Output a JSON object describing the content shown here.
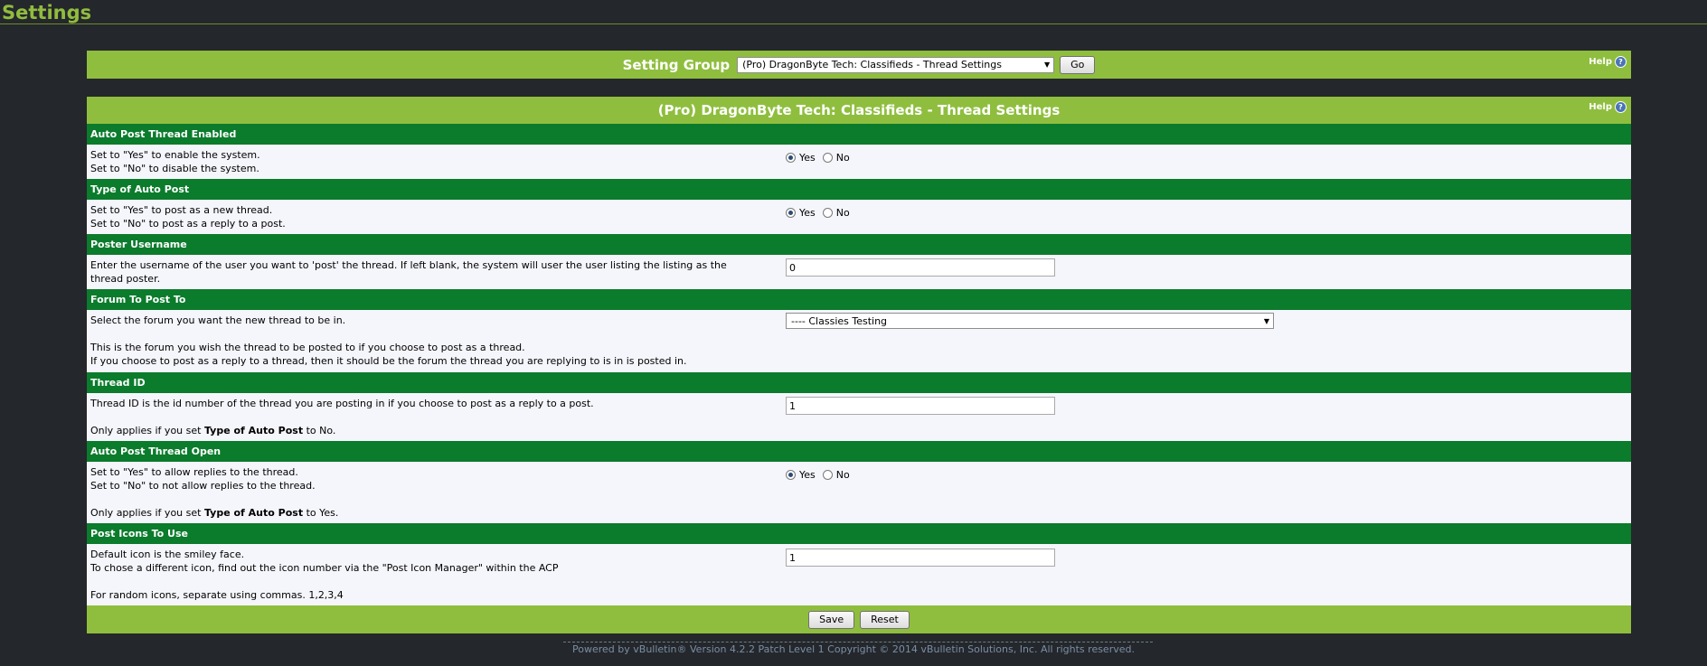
{
  "page": {
    "title": "Settings"
  },
  "group": {
    "label": "Setting Group",
    "selected": "(Pro) DragonByte Tech: Classifieds - Thread Settings",
    "go_label": "Go",
    "help_label": "Help"
  },
  "table": {
    "title": "(Pro) DragonByte Tech: Classifieds - Thread Settings",
    "help_label": "Help"
  },
  "settings": {
    "auto_post": {
      "heading": "Auto Post Thread Enabled",
      "desc1": "Set to \"Yes\" to enable the system.",
      "desc2": "Set to \"No\" to disable the system.",
      "yes": "Yes",
      "no": "No",
      "value": "Yes"
    },
    "type_post": {
      "heading": "Type of Auto Post",
      "desc1": "Set to \"Yes\" to post as a new thread.",
      "desc2": "Set to \"No\" to post as a reply to a post.",
      "yes": "Yes",
      "no": "No",
      "value": "Yes"
    },
    "poster": {
      "heading": "Poster Username",
      "desc1": "Enter the username of the user you want to 'post' the thread. If left blank, the system will user the user listing the listing as the",
      "desc2": "thread poster.",
      "value": "0"
    },
    "forum": {
      "heading": "Forum To Post To",
      "desc1": "Select the forum you want the new thread to be in.",
      "desc2": "This is the forum you wish the thread to be posted to if you choose to post as a thread.",
      "desc3": "If you choose to post as a reply to a thread, then it should be the forum the thread you are replying to is in is posted in.",
      "selected": "---- Classies Testing"
    },
    "thread_id": {
      "heading": "Thread ID",
      "desc1": "Thread ID is the id number of the thread you are posting in if you choose to post as a reply to a post.",
      "note_prefix": "Only applies if you set ",
      "note_bold": "Type of Auto Post",
      "note_suffix": " to No.",
      "value": "1"
    },
    "thread_open": {
      "heading": "Auto Post Thread Open",
      "desc1": "Set to \"Yes\" to allow replies to the thread.",
      "desc2": "Set to \"No\" to not allow replies to the thread.",
      "note_prefix": "Only applies if you set ",
      "note_bold": "Type of Auto Post",
      "note_suffix": " to Yes.",
      "yes": "Yes",
      "no": "No",
      "value": "Yes"
    },
    "post_icons": {
      "heading": "Post Icons To Use",
      "desc1": "Default icon is the smiley face.",
      "desc2": "To chose a different icon, find out the icon number via the \"Post Icon Manager\" within the ACP",
      "desc3": "For random icons, separate using commas. 1,2,3,4",
      "value": "1"
    }
  },
  "actions": {
    "save": "Save",
    "reset": "Reset"
  },
  "footer": {
    "copyright": "Powered by vBulletin® Version 4.2.2 Patch Level 1 Copyright © 2014 vBulletin Solutions, Inc. All rights reserved."
  }
}
